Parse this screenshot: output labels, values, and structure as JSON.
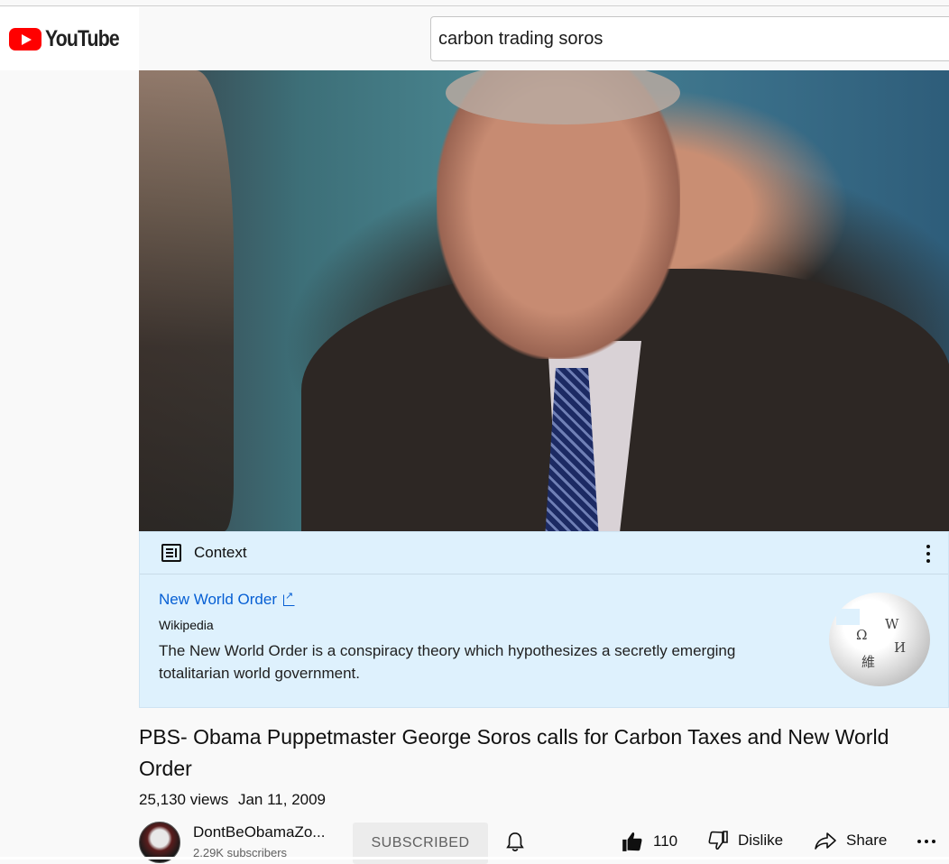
{
  "header": {
    "logo_text": "YouTube",
    "search_value": "carbon trading soros",
    "brand_color": "#ff0000"
  },
  "context_panel": {
    "heading": "Context",
    "link_text": "New World Order",
    "source": "Wikipedia",
    "description": "The New World Order is a conspiracy theory which hypothesizes a secretly emerging totalitarian world government.",
    "background_color": "#def1fd",
    "link_color": "#065fd4",
    "icons": [
      "context-list-icon",
      "external-link-icon",
      "more-vertical-icon",
      "wikipedia-globe-icon"
    ]
  },
  "video": {
    "title": "PBS- Obama Puppetmaster George Soros calls for Carbon Taxes and New World Order",
    "views": "25,130 views",
    "date": "Jan 11, 2009"
  },
  "channel": {
    "name": "DontBeObamaZo...",
    "subscribers": "2.29K subscribers",
    "subscribe_label": "SUBSCRIBED"
  },
  "actions": {
    "like_count": "110",
    "dislike_label": "Dislike",
    "share_label": "Share",
    "icons": [
      "bell-icon",
      "thumbs-up-icon",
      "thumbs-down-icon",
      "share-arrow-icon",
      "more-horizontal-icon"
    ]
  }
}
